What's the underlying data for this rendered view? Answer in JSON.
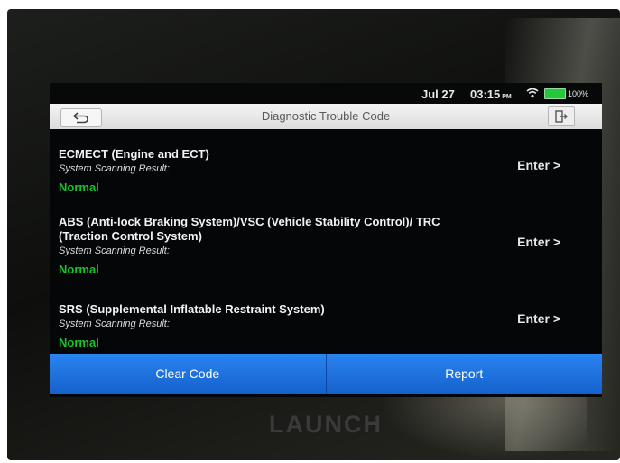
{
  "status_bar": {
    "date": "Jul 27",
    "time": "03:15",
    "ampm": "PM",
    "battery": "100%"
  },
  "title_bar": {
    "title": "Diagnostic Trouble Code"
  },
  "systems": [
    {
      "title": "ECMECT (Engine and ECT)",
      "subtitle": "System Scanning Result:",
      "status": "Normal",
      "action": "Enter >"
    },
    {
      "title": "ABS (Anti-lock Braking System)/VSC (Vehicle Stability Control)/ TRC (Traction Control System)",
      "subtitle": "System Scanning Result:",
      "status": "Normal",
      "action": "Enter >"
    },
    {
      "title": "SRS (Supplemental Inflatable Restraint System)",
      "subtitle": "System Scanning Result:",
      "status": "Normal",
      "action": "Enter >"
    }
  ],
  "bottom_bar": {
    "clear_code": "Clear Code",
    "report": "Report"
  },
  "device": {
    "brand": "LAUNCH"
  },
  "colors": {
    "status_normal": "#18c42c",
    "button_blue": "#1f73e0",
    "battery_green": "#25c83a"
  },
  "icons": {
    "back": "back-arrow-icon",
    "exit": "exit-icon",
    "wifi": "wifi-icon",
    "battery": "battery-icon"
  }
}
